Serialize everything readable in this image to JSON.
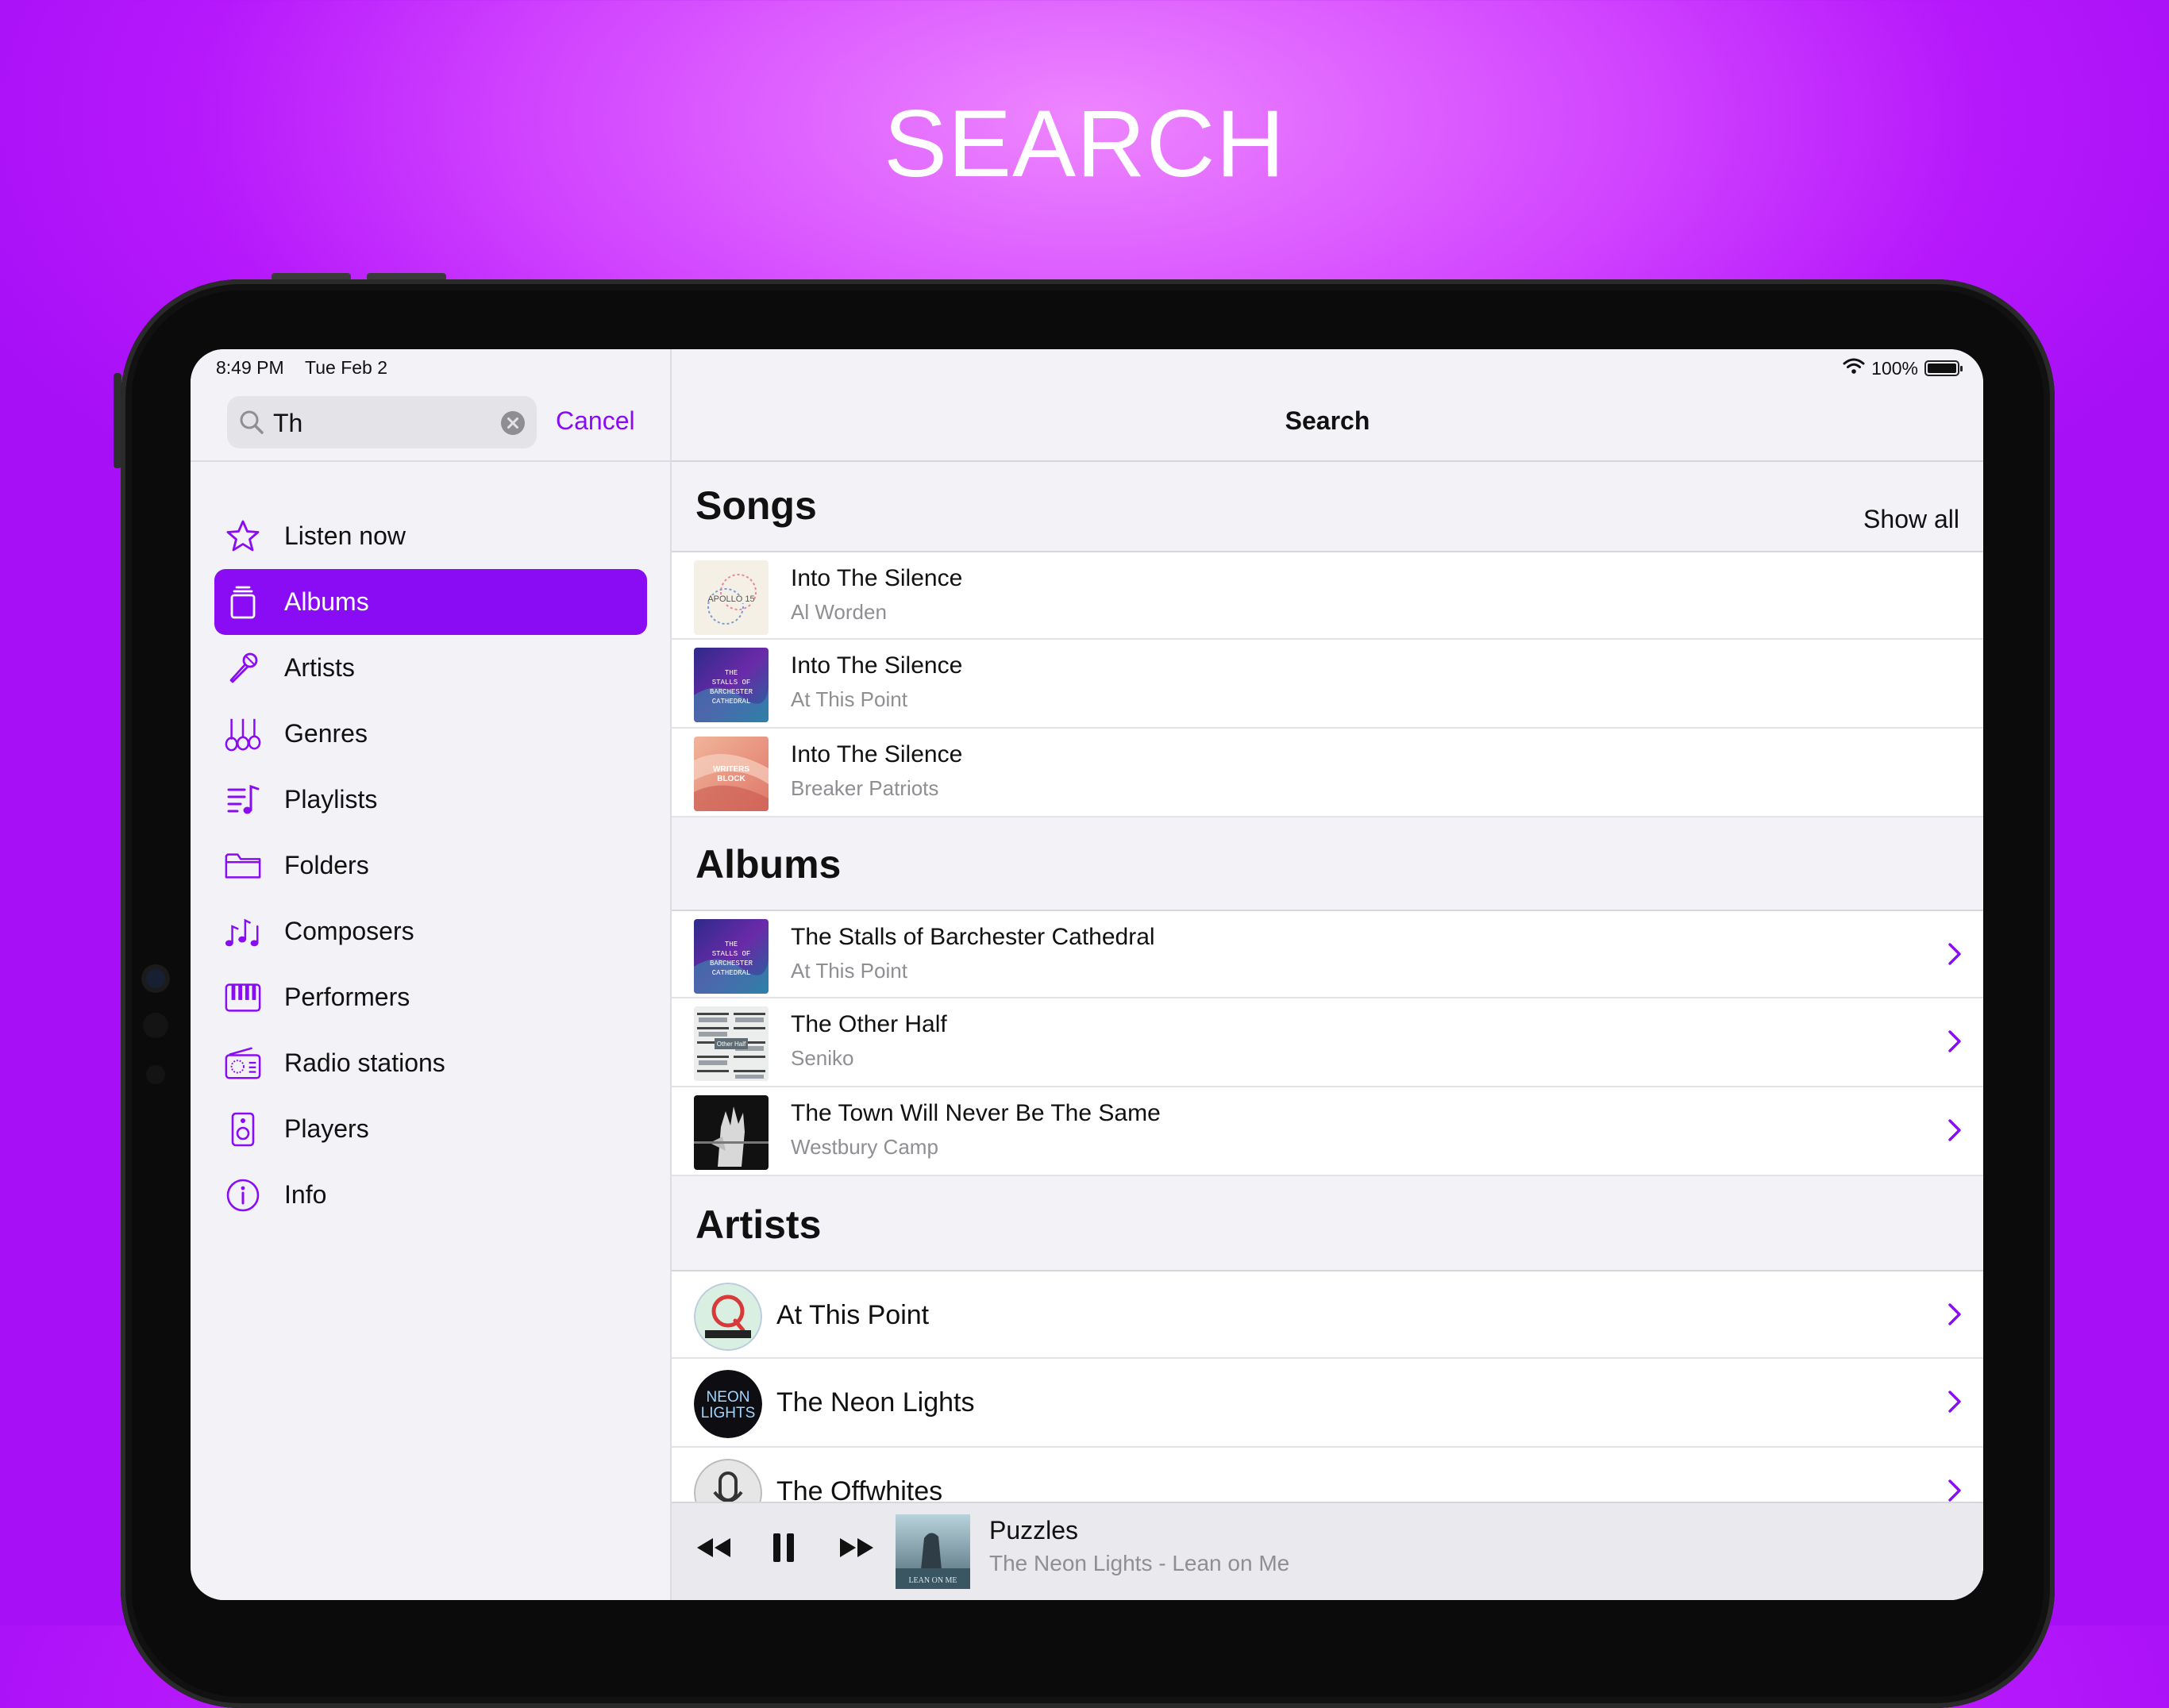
{
  "headline": "SEARCH",
  "status": {
    "time": "8:49 PM",
    "date": "Tue Feb 2",
    "battery": "100%"
  },
  "search": {
    "value": "Th",
    "cancel_label": "Cancel"
  },
  "nav": [
    {
      "label": "Listen now",
      "icon": "star-icon"
    },
    {
      "label": "Albums",
      "icon": "albums-icon",
      "active": true
    },
    {
      "label": "Artists",
      "icon": "microphone-icon"
    },
    {
      "label": "Genres",
      "icon": "guitars-icon"
    },
    {
      "label": "Playlists",
      "icon": "playlist-icon"
    },
    {
      "label": "Folders",
      "icon": "folder-icon"
    },
    {
      "label": "Composers",
      "icon": "music-notes-icon"
    },
    {
      "label": "Performers",
      "icon": "piano-icon"
    },
    {
      "label": "Radio stations",
      "icon": "radio-icon"
    },
    {
      "label": "Players",
      "icon": "speaker-icon"
    },
    {
      "label": "Info",
      "icon": "info-icon"
    }
  ],
  "main": {
    "title": "Search",
    "songs": {
      "title": "Songs",
      "show_all": "Show all",
      "items": [
        {
          "title": "Into The Silence",
          "artist": "Al Worden"
        },
        {
          "title": "Into The Silence",
          "artist": "At This Point"
        },
        {
          "title": "Into The Silence",
          "artist": "Breaker Patriots"
        }
      ]
    },
    "albums": {
      "title": "Albums",
      "items": [
        {
          "title": "The Stalls of Barchester Cathedral",
          "artist": "At This Point"
        },
        {
          "title": "The Other Half",
          "artist": "Seniko"
        },
        {
          "title": "The Town Will Never Be The Same",
          "artist": "Westbury Camp"
        }
      ]
    },
    "artists": {
      "title": "Artists",
      "items": [
        {
          "name": "At This Point"
        },
        {
          "name": "The Neon Lights"
        },
        {
          "name": "The Offwhites"
        }
      ]
    }
  },
  "now_playing": {
    "title": "Puzzles",
    "subtitle": "The Neon Lights - Lean on Me"
  },
  "colors": {
    "accent": "#8a0cf4",
    "background_top": "#ee86ff",
    "background_bottom": "#a70ff7"
  }
}
